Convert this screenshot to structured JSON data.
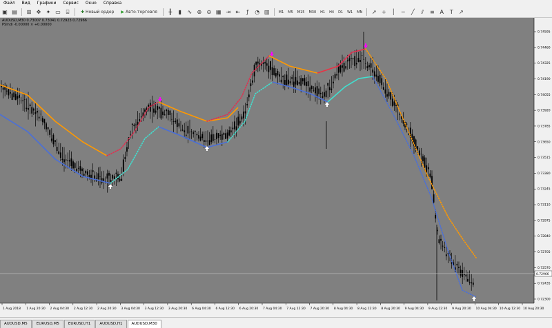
{
  "menu": [
    "Файл",
    "Вид",
    "Графики",
    "Сервис",
    "Окно",
    "Справка"
  ],
  "toolbar": {
    "new_order": "Новый ордер",
    "auto_trading": "Авто-торговля",
    "timeframes": [
      "M1",
      "M5",
      "M15",
      "M30",
      "H1",
      "H4",
      "D1",
      "W1",
      "MN"
    ]
  },
  "chart": {
    "symbol_info": "AUDUSD,M30  0.73007 0.73041 0.72923 0.72966",
    "indicator_info": "PSIndi  -0.00000  ×  +0.00000",
    "current_price": "0.72966",
    "price_labels": [
      "0.74595",
      "0.74460",
      "0.74325",
      "0.74190",
      "0.74055",
      "0.73920",
      "0.73785",
      "0.73650",
      "0.73515",
      "0.73380",
      "0.73245",
      "0.73110",
      "0.72975",
      "0.72840",
      "0.72705",
      "0.72570",
      "0.72435",
      "0.72300"
    ],
    "time_labels": [
      "1 Aug 2018",
      "1 Aug 20:30",
      "2 Aug 04:30",
      "2 Aug 12:30",
      "2 Aug 20:30",
      "3 Aug 04:30",
      "3 Aug 12:30",
      "3 Aug 20:30",
      "6 Aug 04:30",
      "6 Aug 12:30",
      "6 Aug 20:30",
      "7 Aug 04:30",
      "7 Aug 12:30",
      "7 Aug 20:30",
      "8 Aug 04:30",
      "8 Aug 12:30",
      "8 Aug 20:30",
      "9 Aug 04:30",
      "9 Aug 12:30",
      "9 Aug 20:30",
      "10 Aug 04:30",
      "10 Aug 12:30",
      "10 Aug 20:30"
    ],
    "colors": {
      "background": "#808080",
      "candle": "#000000",
      "upper_band": "#ff9900",
      "upper_band_alt": "#e03050",
      "lower_band": "#4a6fd8",
      "lower_band_alt": "#40e0d0",
      "arrow_up": "#ffffff",
      "arrow_down": "#ff00ff",
      "price_line": "#b8b8b8"
    }
  },
  "tabs": [
    "AUDUSD,M5",
    "EURUSD,M5",
    "EURUSD,H1",
    "AUDUSD,H1",
    "AUDUSD,M30"
  ]
}
